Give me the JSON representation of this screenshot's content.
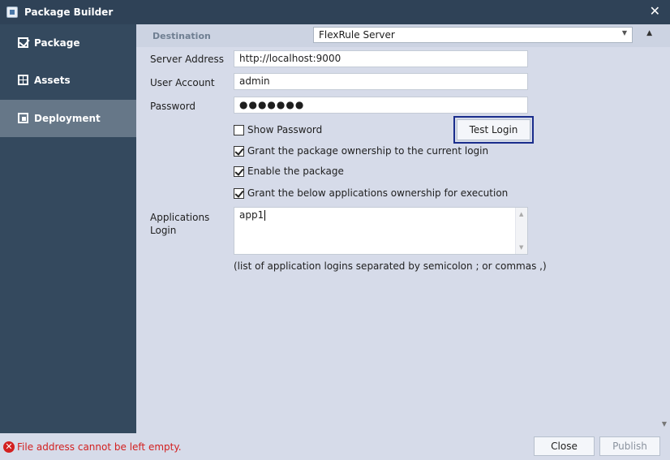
{
  "window": {
    "title": "Package Builder",
    "close_glyph": "✕"
  },
  "sidebar": {
    "items": [
      {
        "label": "Package",
        "icon": "package-check-icon",
        "active": false
      },
      {
        "label": "Assets",
        "icon": "assets-grid-icon",
        "active": false
      },
      {
        "label": "Deployment",
        "icon": "deployment-icon",
        "active": true
      }
    ]
  },
  "form": {
    "destination": {
      "label": "Destination",
      "value": "FlexRule Server"
    },
    "server_address": {
      "label": "Server Address",
      "value": "http://localhost:9000"
    },
    "user_account": {
      "label": "User Account",
      "value": "admin"
    },
    "password": {
      "label": "Password",
      "masked_value": "●●●●●●●"
    },
    "show_password": {
      "label": "Show Password",
      "checked": false
    },
    "grant_ownership": {
      "label": "Grant the package ownership to the current login",
      "checked": true
    },
    "enable_package": {
      "label": "Enable the package",
      "checked": true
    },
    "grant_apps": {
      "label": "Grant the below applications ownership for execution",
      "checked": true
    },
    "applications_login": {
      "label": "Applications Login",
      "value": "app1",
      "help": "(list of application logins separated by semicolon ; or commas ,)"
    },
    "test_login_label": "Test Login"
  },
  "footer": {
    "error": "File address cannot be left empty.",
    "error_icon_glyph": "✕",
    "close_label": "Close",
    "publish_label": "Publish"
  },
  "colors": {
    "titlebar": "#2f4257",
    "sidebar": "#34495e",
    "sidebar_active": "#667788",
    "content_bg": "#d6dbe9",
    "error": "#d32020",
    "focus_border": "#1a2d8c"
  }
}
